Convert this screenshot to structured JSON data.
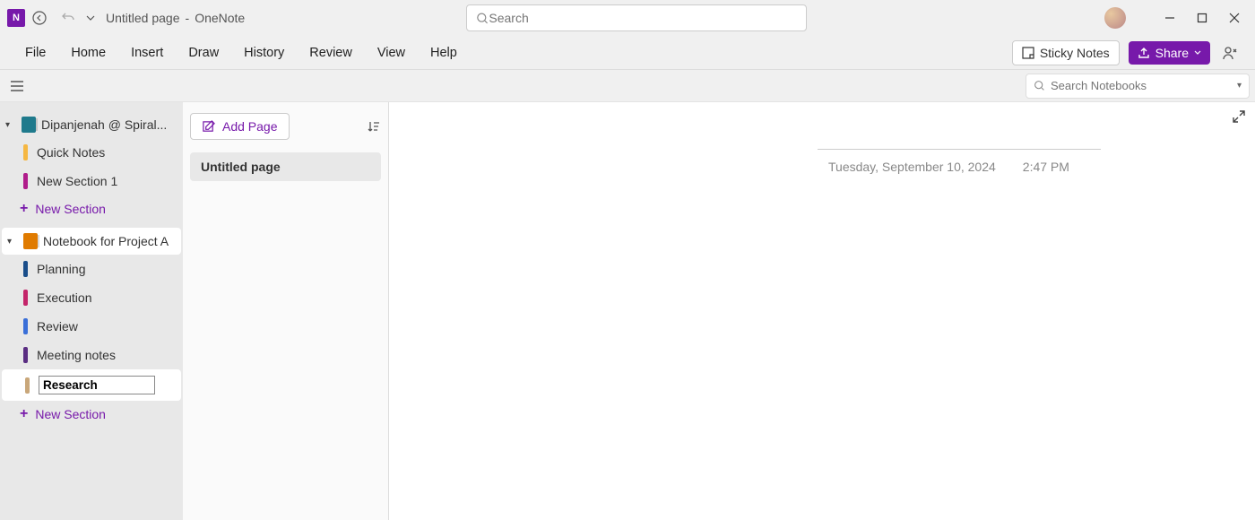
{
  "title": {
    "page": "Untitled page",
    "sep": "-",
    "app": "OneNote"
  },
  "search": {
    "placeholder": "Search"
  },
  "menu": {
    "file": "File",
    "home": "Home",
    "insert": "Insert",
    "draw": "Draw",
    "history": "History",
    "review": "Review",
    "view": "View",
    "help": "Help"
  },
  "toolbar": {
    "sticky": "Sticky Notes",
    "share": "Share"
  },
  "subbar": {
    "notebook_search_placeholder": "Search Notebooks"
  },
  "sidebar": {
    "nb1": {
      "label": "Dipanjenah @ Spiral..."
    },
    "nb1_sections": [
      {
        "label": "Quick Notes",
        "color": "#f5b742"
      },
      {
        "label": "New Section 1",
        "color": "#b01c8b"
      }
    ],
    "new_section": "New Section",
    "nb2": {
      "label": "Notebook for Project A"
    },
    "nb2_sections": [
      {
        "label": "Planning",
        "color": "#1a4e8a"
      },
      {
        "label": "Execution",
        "color": "#c4256a"
      },
      {
        "label": "Review",
        "color": "#3a6fd8"
      },
      {
        "label": "Meeting notes",
        "color": "#5a2d82"
      }
    ],
    "editing_section": "Research",
    "editing_color": "#c9a77a"
  },
  "pagelist": {
    "add_page": "Add Page",
    "pages": [
      {
        "label": "Untitled page"
      }
    ]
  },
  "canvas": {
    "date": "Tuesday, September 10, 2024",
    "time": "2:47 PM"
  }
}
